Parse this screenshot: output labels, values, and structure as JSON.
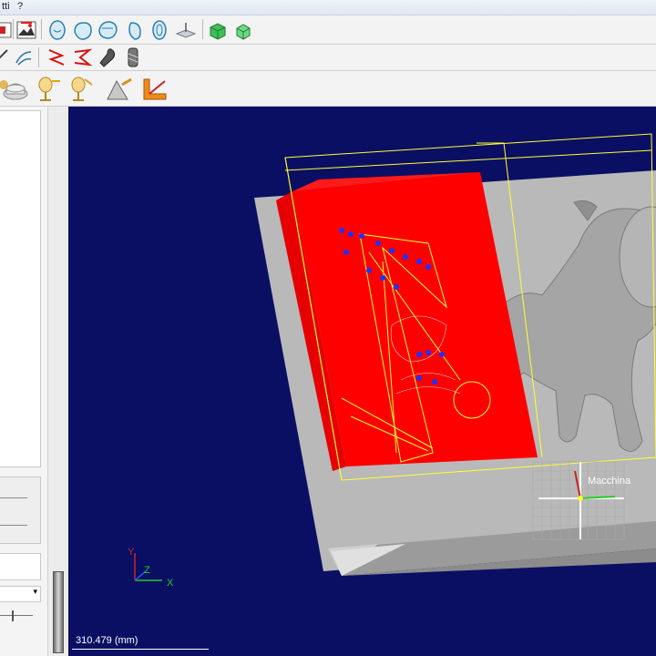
{
  "menubar": {
    "item_partial": "tti",
    "help": "?"
  },
  "viewport": {
    "background_color": "#0a0f63",
    "scale_readout": "310.479 (mm)",
    "machine_label": "Macchina",
    "axes": {
      "x": "X",
      "y": "Y",
      "z": "Z"
    },
    "colors": {
      "stock": "#ff0000",
      "model": "#a8a8a8",
      "toolpath": "#ffff33",
      "plunge": "#1a33ff"
    }
  },
  "toolbars": {
    "row1_icons": [
      "view-icon",
      "export-image-icon",
      "head-front-icon",
      "head-left-icon",
      "head-iso-icon",
      "head-right-icon",
      "head-back-icon",
      "plane-icon",
      "green-cube-icon",
      "green-cube-small-icon"
    ],
    "row2_icons": [
      "path-icon",
      "toolpath-red-icon",
      "toolpath-red-2-icon",
      "cutter-icon",
      "drill-icon"
    ],
    "row3_icons": [
      "pawn-icon",
      "base-icon",
      "lamp-icon",
      "lamp-2-icon",
      "cone-icon",
      "orange-corner-icon"
    ]
  }
}
